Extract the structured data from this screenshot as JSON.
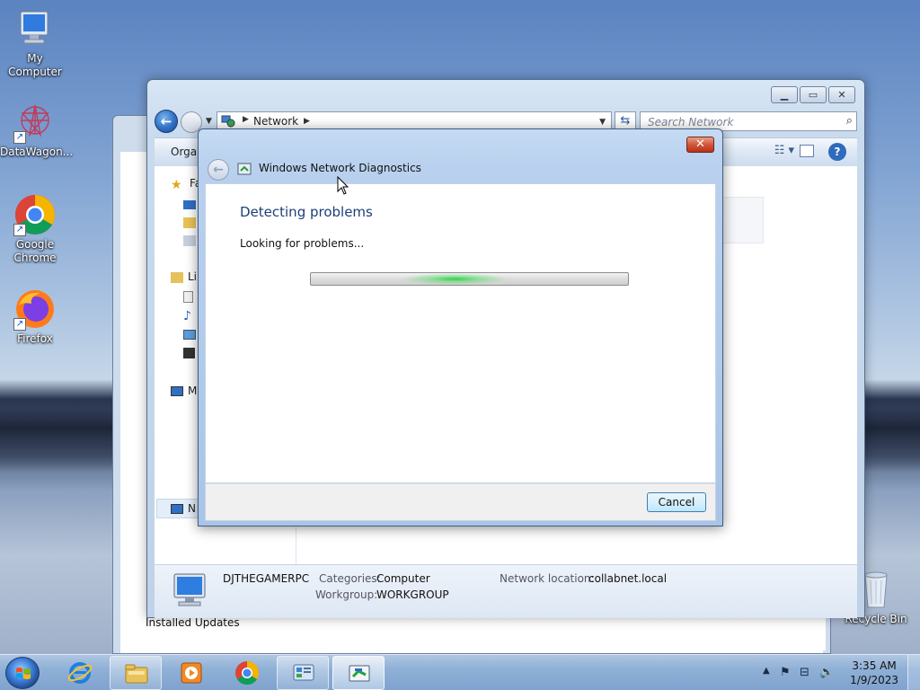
{
  "desktop": {
    "icons": [
      {
        "label": "My Computer"
      },
      {
        "label": "DataWagon..."
      },
      {
        "label": "Google Chrome"
      },
      {
        "label": "Firefox"
      },
      {
        "label": "Recycle Bin"
      }
    ]
  },
  "explorer": {
    "address": "Network",
    "search_placeholder": "Search Network",
    "toolbar_first": "Organ",
    "nav_letters": [
      "Fa",
      "Li",
      "M",
      "N"
    ],
    "details": {
      "computer_name": "DJTHEGAMERPC",
      "categories_label": "Categories:",
      "categories_value": "Computer",
      "workgroup_label": "Workgroup:",
      "workgroup_value": "WORKGROUP",
      "location_label": "Network location:",
      "location_value": "collabnet.local"
    },
    "behind_text": "Installed Updates"
  },
  "dialog": {
    "title": "Windows Network Diagnostics",
    "heading": "Detecting problems",
    "status": "Looking for problems...",
    "cancel_label": "Cancel",
    "progress_indeterminate": true
  },
  "taskbar": {
    "time": "3:35 AM",
    "date": "1/9/2023"
  },
  "colors": {
    "accent": "#1e3f79",
    "progress_glow": "#28d23c"
  }
}
